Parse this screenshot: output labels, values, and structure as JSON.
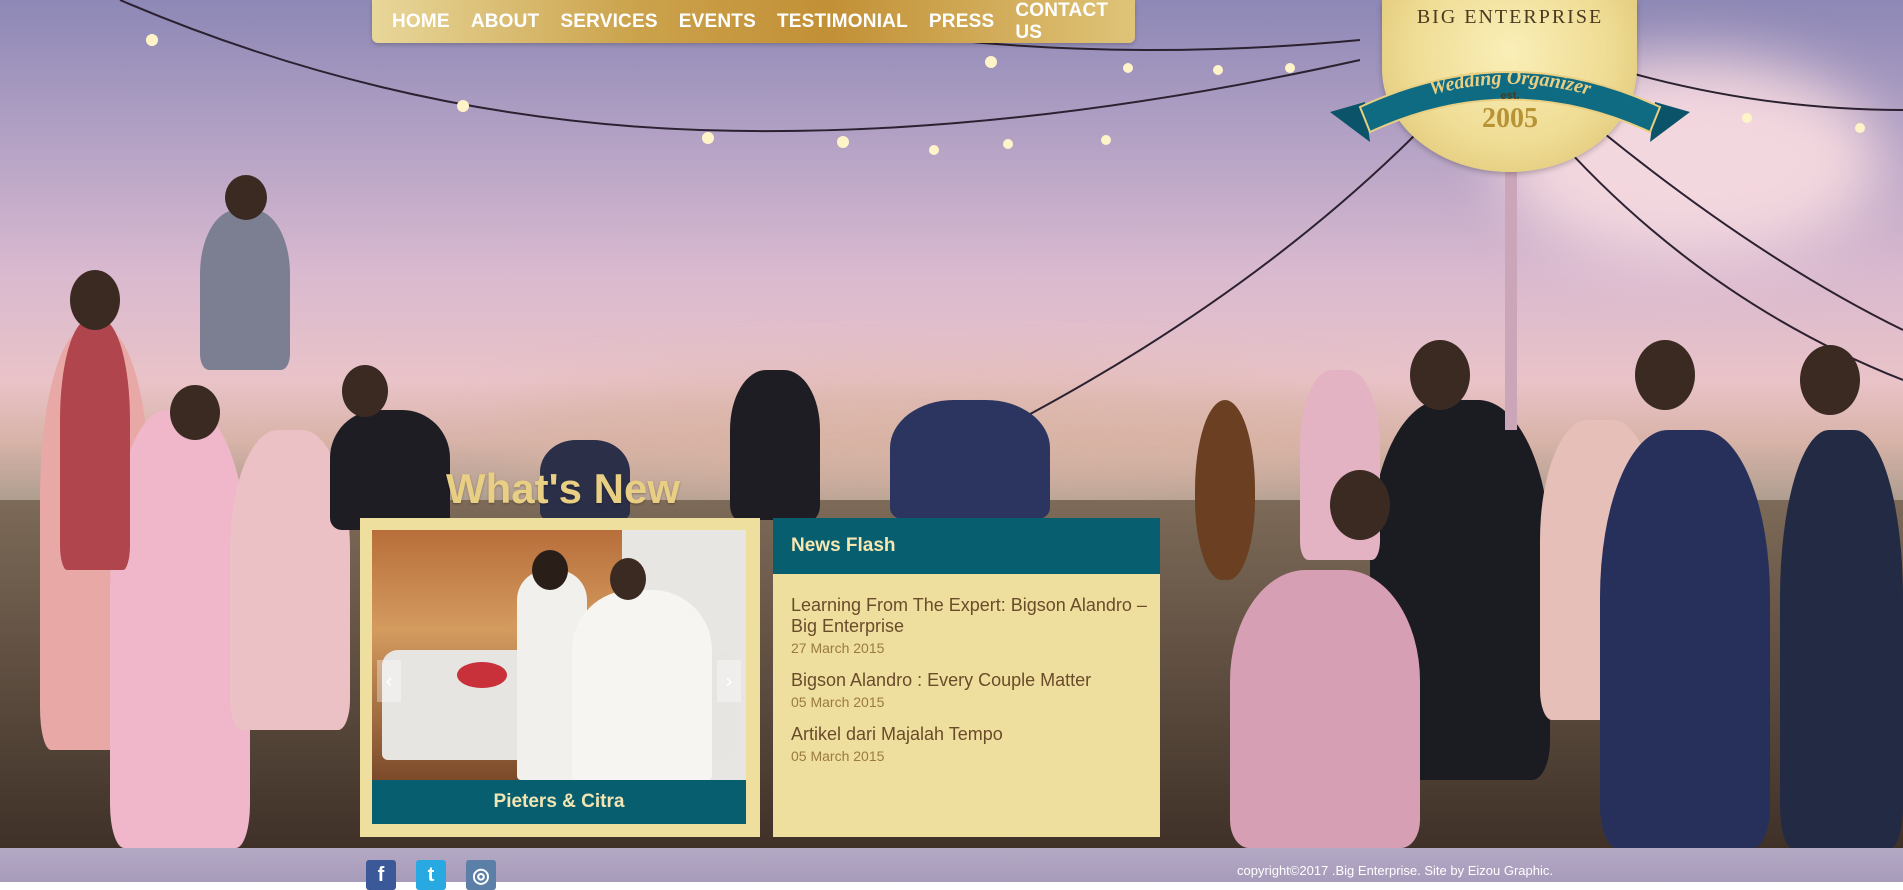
{
  "nav": {
    "items": [
      "HOME",
      "ABOUT",
      "SERVICES",
      "EVENTS",
      "TESTIMONIAL",
      "PRESS",
      "CONTACT US"
    ]
  },
  "logo": {
    "brand": "BIG ENTERPRISE",
    "tagline": "Wedding Organizer",
    "est": "est.",
    "year": "2005"
  },
  "whats_new": {
    "heading": "What's New",
    "slide_caption": "Pieters & Citra",
    "prev_icon": "chevron-left-icon",
    "next_icon": "chevron-right-icon"
  },
  "news_flash": {
    "heading": "News Flash",
    "items": [
      {
        "title": "Learning From The Expert: Bigson Alandro – Big Enterprise",
        "date": "27 March 2015"
      },
      {
        "title": "Bigson Alandro : Every Couple Matter",
        "date": "05 March 2015"
      },
      {
        "title": "Artikel dari Majalah Tempo",
        "date": "05 March 2015"
      }
    ]
  },
  "footer": {
    "social": [
      {
        "icon": "facebook-icon",
        "glyph": "f",
        "color": "#3b5998"
      },
      {
        "icon": "twitter-icon",
        "glyph": "t",
        "color": "#29a9e1"
      },
      {
        "icon": "instagram-icon",
        "glyph": "◎",
        "color": "#5b7fa6"
      }
    ],
    "copyright": "copyright©2017 .Big Enterprise. Site by Eizou Graphic."
  },
  "colors": {
    "teal": "#075e6e",
    "cream": "#efdf9f",
    "gold": "#c29036"
  }
}
